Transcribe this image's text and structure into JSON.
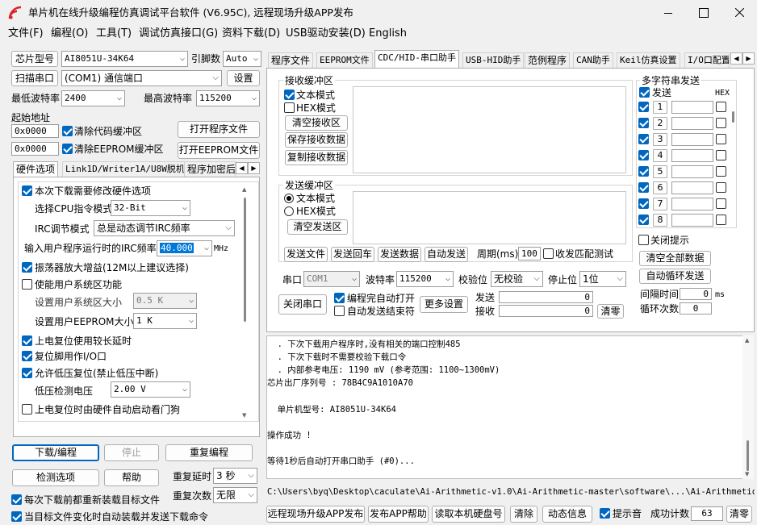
{
  "window": {
    "title": "单片机在线升级编程仿真调试平台软件 (V6.95C), 远程现场升级APP发布",
    "menu": [
      "文件(F)",
      "编程(O)",
      "工具(T)",
      "调试仿真接口(G)",
      "资料下载(D)",
      "USB驱动安装(D)",
      "English"
    ]
  },
  "left": {
    "chip_label": "芯片型号",
    "chip_value": "AI8051U-34K64",
    "pin_label": "引脚数",
    "pin_value": "Auto",
    "scan_label": "扫描串口",
    "port_value": "(COM1) 通信端口",
    "settings_label": "设置",
    "min_baud_label": "最低波特率",
    "min_baud_value": "2400",
    "max_baud_label": "最高波特率",
    "max_baud_value": "115200",
    "start_addr_label": "起始地址",
    "addr1": "0x0000",
    "clear_code_label": "清除代码缓冲区",
    "open_prog_label": "打开程序文件",
    "addr2": "0x0000",
    "clear_eeprom_label": "清除EEPROM缓冲区",
    "open_eeprom_label": "打开EEPROM文件",
    "tabs": [
      "硬件选项",
      "Link1D/Writer1A/U8W脱机",
      "程序加密后"
    ]
  },
  "hw": {
    "opt1": "本次下载需要修改硬件选项",
    "cpu_label": "选择CPU指令模式",
    "cpu_value": "32-Bit",
    "irc_label": "IRC调节模式",
    "irc_value": "总是动态调节IRC频率",
    "freq_label": "输入用户程序运行时的IRC频率",
    "freq_value": "40.000",
    "freq_unit": "MHz",
    "opt2": "振荡器放大增益(12M以上建议选择)",
    "opt3": "使能用户系统区功能",
    "sys_size_label": "设置用户系统区大小",
    "sys_size_value": "0.5 K",
    "eeprom_size_label": "设置用户EEPROM大小",
    "eeprom_size_value": "1   K",
    "opt4": "上电复位使用较长延时",
    "opt5": "复位脚用作I/O口",
    "opt6": "允许低压复位(禁止低压中断)",
    "lv_label": "低压检测电压",
    "lv_value": "2.00 V",
    "opt7": "上电复位时由硬件自动启动看门狗"
  },
  "bottom_left": {
    "download": "下载/编程",
    "stop": "停止",
    "reprog": "重复编程",
    "check": "检测选项",
    "help": "帮助",
    "delay_label": "重复延时",
    "delay_value": "3 秒",
    "count_label": "重复次数",
    "count_value": "无限",
    "reload_label": "每次下载前都重新装载目标文件",
    "auto_label": "当目标文件变化时自动装载并发送下载命令"
  },
  "right_tabs": [
    "程序文件",
    "EEPROM文件",
    "CDC/HID-串口助手",
    "USB-HID助手",
    "范例程序",
    "CAN助手",
    "Keil仿真设置",
    "I/O口配置"
  ],
  "serial": {
    "recv_title": "接收缓冲区",
    "text_mode": "文本模式",
    "hex_mode": "HEX模式",
    "clear_recv": "清空接收区",
    "save_recv": "保存接收数据",
    "copy_recv": "复制接收数据",
    "send_title": "发送缓冲区",
    "clear_send": "清空发送区",
    "send_file": "发送文件",
    "send_return": "发送回车",
    "send_data": "发送数据",
    "auto_send": "自动发送",
    "period_label": "周期(ms)",
    "period_value": "100",
    "match_label": "收发匹配测试",
    "port_label": "串口",
    "port_value": "COM1",
    "baud_label": "波特率",
    "baud_value": "115200",
    "parity_label": "校验位",
    "parity_value": "无校验",
    "stop_label": "停止位",
    "stop_value": "1位",
    "close_port": "关闭串口",
    "auto_open": "编程完自动打开",
    "auto_send_end": "自动发送结束符",
    "more_settings": "更多设置",
    "send_label": "发送",
    "send_count": "0",
    "recv_label": "接收",
    "recv_count": "0",
    "clear_zero": "清零"
  },
  "multi": {
    "title": "多字符串发送",
    "send_label": "发送",
    "hex_label": "HEX",
    "rows": [
      "1",
      "2",
      "3",
      "4",
      "5",
      "6",
      "7",
      "8"
    ],
    "close_tip": "关闭提示",
    "clear_all": "清空全部数据",
    "auto_loop": "自动循环发送",
    "interval_label": "间隔时间",
    "interval_value": "0",
    "interval_unit": "ms",
    "loop_label": "循环次数",
    "loop_value": "0"
  },
  "log": {
    "lines": [
      "  . 下次下载用户程序时,没有相关的端口控制485",
      "  . 下次下载时不需要校验下载口令",
      "  . 内部参考电压: 1190 mV (参考范围: 1100~1300mV)",
      "芯片出厂序列号 : 78B4C9A1010A70",
      "",
      "  单片机型号: AI8051U-34K64",
      "",
      "操作成功 !",
      "",
      "等待1秒后自动打开串口助手 (#0)..."
    ]
  },
  "path": "C:\\Users\\byq\\Desktop\\caculate\\Ai-Arithmetic-v1.0\\Ai-Arithmetic-master\\software\\...\\Ai-Arithmetic.hex",
  "statusbar": {
    "publish": "远程现场升级APP发布",
    "publish_help": "发布APP帮助",
    "read_disk": "读取本机硬盘号",
    "clear": "清除",
    "anim": "动态信息",
    "sound": "提示音",
    "success_label": "成功计数",
    "success_value": "63",
    "clear_zero": "清零"
  },
  "colors": {
    "accent": "#0067c0",
    "title_icon": "#d9262c"
  }
}
